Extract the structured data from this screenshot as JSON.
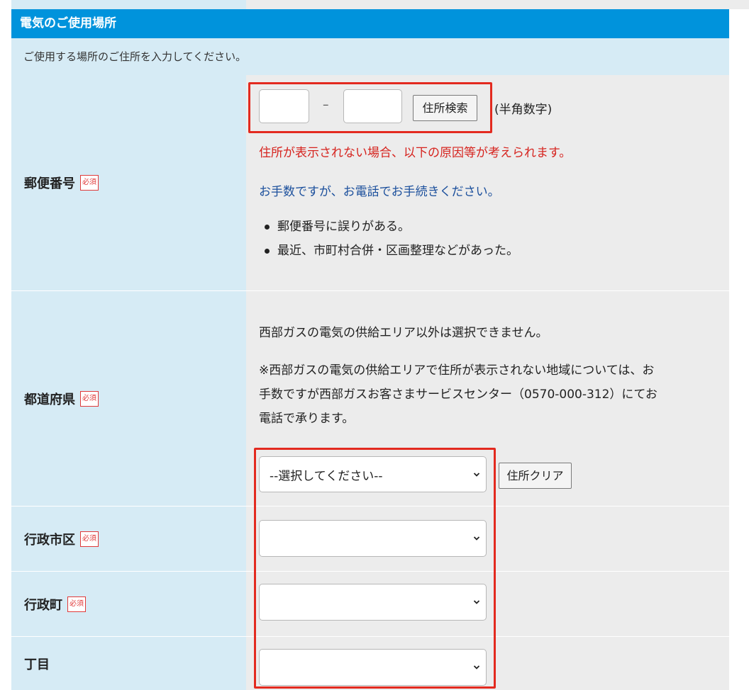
{
  "section": {
    "title": "電気のご使用場所",
    "intro": "ご使用する場所のご住所を入力してください。"
  },
  "required_badge": "必須",
  "postal": {
    "label": "郵便番号",
    "first_value": "",
    "second_value": "",
    "dash": "–",
    "search_button": "住所検索",
    "hint": "(半角数字)",
    "warning": "住所が表示されない場合、以下の原因等が考えられます。",
    "contact_note": "お手数ですが、お電話でお手続きください。",
    "causes": [
      "郵便番号に誤りがある。",
      "最近、市町村合併・区画整理などがあった。"
    ]
  },
  "prefecture": {
    "label": "都道府県",
    "note": "西部ガスの電気の供給エリア以外は選択できません。",
    "note2_lines": [
      "※西部ガスの電気の供給エリアで住所が表示されない地域については、お",
      "手数ですが西部ガスお客さまサービスセンター（0570-000-312）にてお",
      "電話で承ります。"
    ],
    "selected": "--選択してください--",
    "clear_button": "住所クリア"
  },
  "city": {
    "label": "行政市区",
    "selected": ""
  },
  "town": {
    "label": "行政町",
    "selected": ""
  },
  "chome": {
    "label": "丁目",
    "selected": ""
  },
  "colors": {
    "header_bg": "#0093dc",
    "label_bg": "#d6ebf5",
    "content_bg": "#ececec",
    "warning_red": "#d6231e",
    "note_blue": "#1b4f9c",
    "highlight_red": "#e32a1f"
  }
}
